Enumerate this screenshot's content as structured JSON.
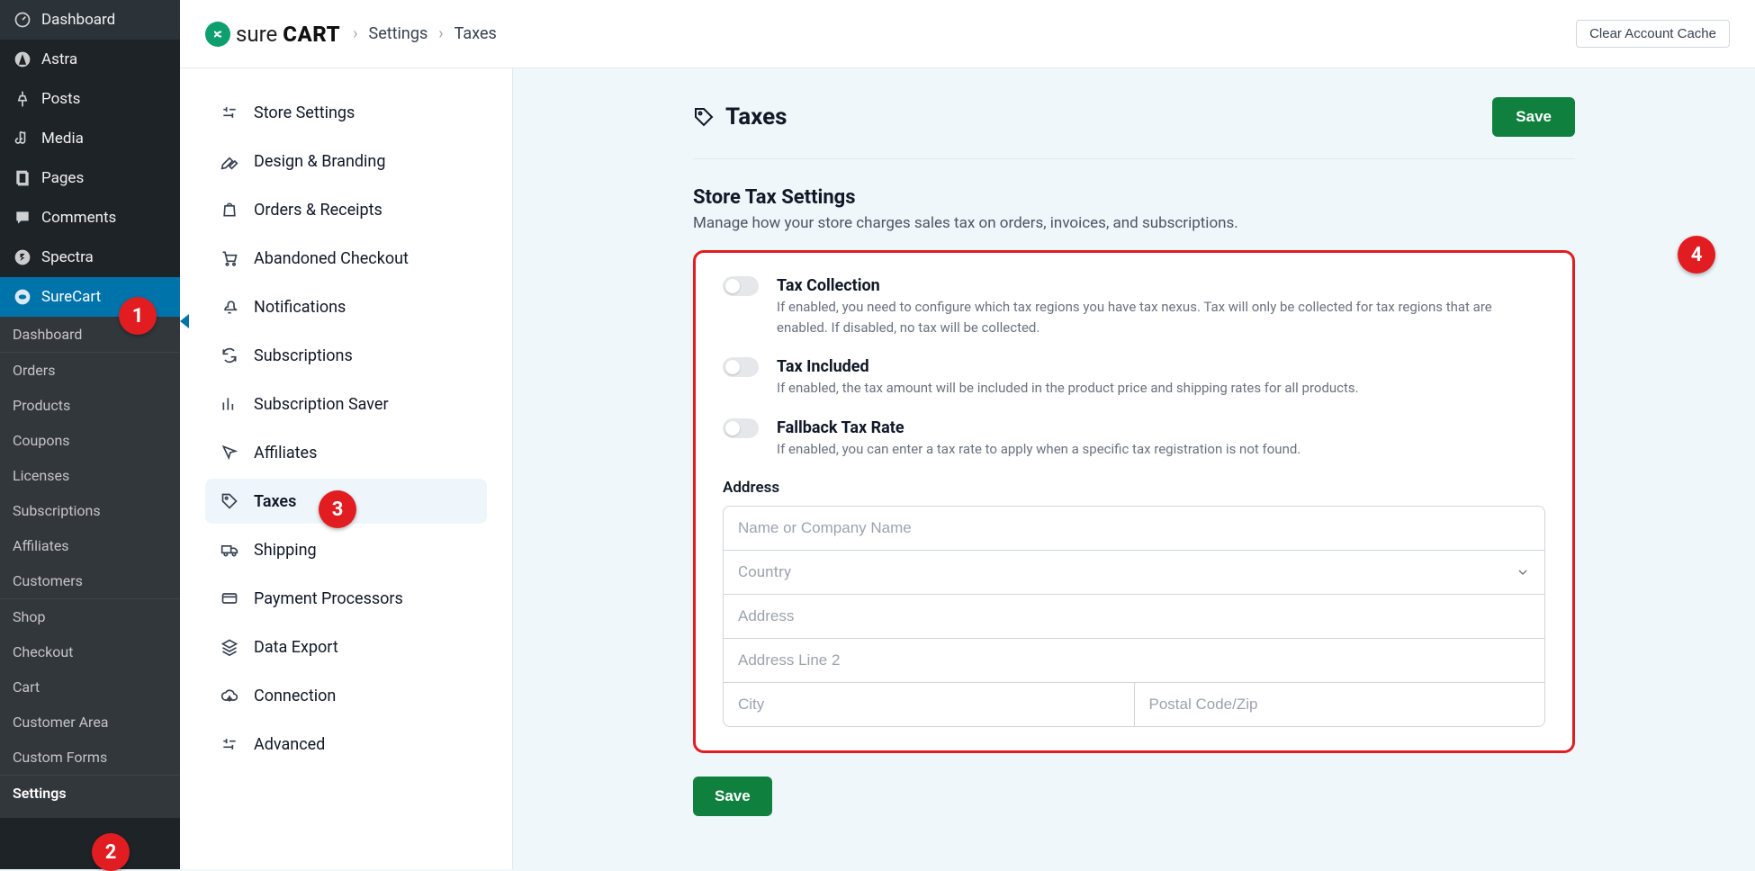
{
  "brand": {
    "name1": "sure",
    "name2": "CART"
  },
  "breadcrumbs": {
    "item1": "Settings",
    "item2": "Taxes"
  },
  "topbar": {
    "clear_cache": "Clear Account Cache"
  },
  "wp_sidebar": {
    "items": [
      {
        "label": "Dashboard",
        "icon": "gauge"
      },
      {
        "label": "Astra",
        "icon": "astra"
      },
      {
        "label": "Posts",
        "icon": "pin"
      },
      {
        "label": "Media",
        "icon": "media"
      },
      {
        "label": "Pages",
        "icon": "page"
      },
      {
        "label": "Comments",
        "icon": "comment"
      },
      {
        "label": "Spectra",
        "icon": "spectra"
      },
      {
        "label": "SureCart",
        "icon": "surecart",
        "active": true
      }
    ],
    "sub": [
      "Dashboard",
      "Orders",
      "Products",
      "Coupons",
      "Licenses",
      "Subscriptions",
      "Affiliates",
      "Customers",
      "Shop",
      "Checkout",
      "Cart",
      "Customer Area",
      "Custom Forms",
      "Settings"
    ]
  },
  "settings_side": [
    {
      "label": "Store Settings",
      "icon": "sliders"
    },
    {
      "label": "Design & Branding",
      "icon": "pen"
    },
    {
      "label": "Orders & Receipts",
      "icon": "bag"
    },
    {
      "label": "Abandoned Checkout",
      "icon": "cart"
    },
    {
      "label": "Notifications",
      "icon": "bell"
    },
    {
      "label": "Subscriptions",
      "icon": "refresh"
    },
    {
      "label": "Subscription Saver",
      "icon": "chart"
    },
    {
      "label": "Affiliates",
      "icon": "cursor"
    },
    {
      "label": "Taxes",
      "icon": "tag",
      "selected": true
    },
    {
      "label": "Shipping",
      "icon": "truck"
    },
    {
      "label": "Payment Processors",
      "icon": "card"
    },
    {
      "label": "Data Export",
      "icon": "layers"
    },
    {
      "label": "Connection",
      "icon": "cloud"
    },
    {
      "label": "Advanced",
      "icon": "sliders"
    }
  ],
  "page": {
    "title": "Taxes",
    "save": "Save",
    "section_title": "Store Tax Settings",
    "section_subtitle": "Manage how your store charges sales tax on orders, invoices, and subscriptions."
  },
  "toggles": [
    {
      "label": "Tax Collection",
      "desc": "If enabled, you need to configure which tax regions you have tax nexus. Tax will only be collected for tax regions that are enabled. If disabled, no tax will be collected."
    },
    {
      "label": "Tax Included",
      "desc": "If enabled, the tax amount will be included in the product price and shipping rates for all products."
    },
    {
      "label": "Fallback Tax Rate",
      "desc": "If enabled, you can enter a tax rate to apply when a specific tax registration is not found."
    }
  ],
  "address": {
    "heading": "Address",
    "placeholders": {
      "name": "Name or Company Name",
      "country": "Country",
      "address": "Address",
      "address2": "Address Line 2",
      "city": "City",
      "postal": "Postal Code/Zip"
    }
  },
  "badges": {
    "b1": "1",
    "b2": "2",
    "b3": "3",
    "b4": "4"
  }
}
